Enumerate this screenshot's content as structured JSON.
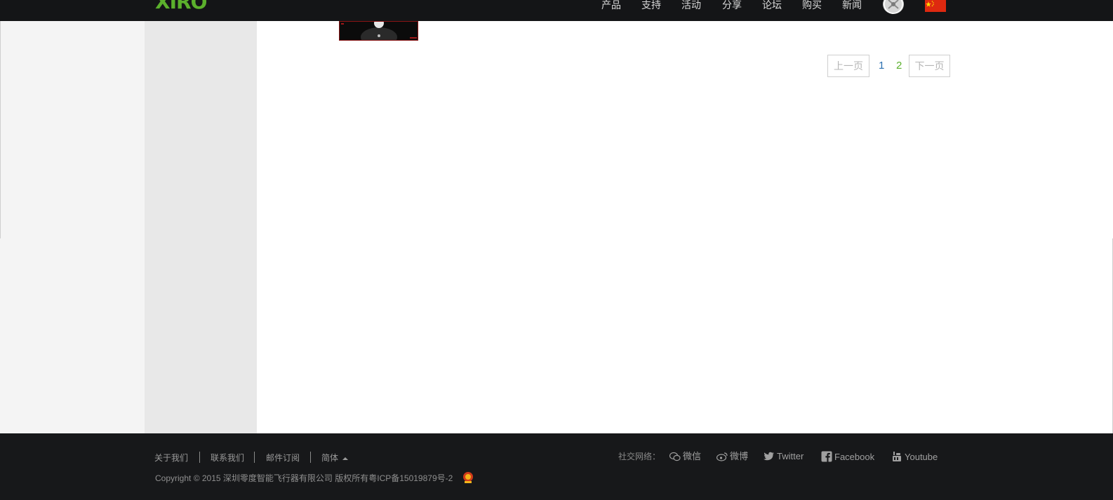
{
  "header": {
    "logo_text": "XIRO",
    "nav": [
      "产品",
      "支持",
      "活动",
      "分享",
      "论坛",
      "购买",
      "新闻"
    ]
  },
  "pagination": {
    "prev": "上一页",
    "pages": [
      "1",
      "2"
    ],
    "next": "下一页"
  },
  "footer": {
    "links": [
      "关于我们",
      "联系我们",
      "邮件订阅",
      "简体"
    ],
    "copyright": "Copyright © 2015 深圳零度智能飞行器有限公司 版权所有粤ICP备15019879号-2",
    "social_label": "社交网络：",
    "social": [
      "微信",
      "微博",
      "Twitter",
      "Facebook",
      "Youtube"
    ]
  },
  "colors": {
    "brand_green": "#5bb02c",
    "topbar_bg": "#141517",
    "footer_bg": "#17181a",
    "page_link_blue": "#2a6fb0",
    "page_link_green": "#5bb02c"
  }
}
